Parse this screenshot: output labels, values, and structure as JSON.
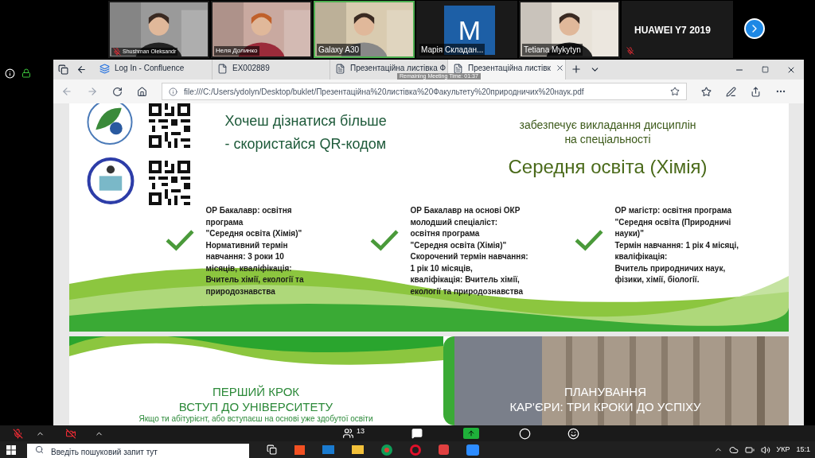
{
  "participants": [
    {
      "kind": "video",
      "name": "Shushman Oleksandr",
      "muted": true,
      "speaking": false
    },
    {
      "kind": "video",
      "name": "Неля Долинко",
      "muted": false,
      "speaking": false
    },
    {
      "kind": "video",
      "name": "Galaxy A30",
      "muted": false,
      "speaking": true
    },
    {
      "kind": "avatar",
      "initial": "M",
      "name": "Марія Складан...",
      "muted": false,
      "speaking": false
    },
    {
      "kind": "video",
      "name": "Tetiana Mykytyn",
      "muted": false,
      "speaking": false
    },
    {
      "kind": "name",
      "name": "HUAWEI Y7 2019",
      "muted": true,
      "speaking": false
    }
  ],
  "browser": {
    "tabs": [
      {
        "label": "Log In - Confluence",
        "selected": false
      },
      {
        "label": "EX002889",
        "selected": false
      },
      {
        "label": "Презентаційна листівка Ф",
        "selected": false
      },
      {
        "label": "Презентаційна листівк",
        "selected": true
      }
    ],
    "meeting_timer": "Remaining Meeting Time: 01:37",
    "url": "file:///C:/Users/ydolyn/Desktop/buklet/Презентаційна%20листівка%20Факультету%20природничих%20наук.pdf"
  },
  "pdf": {
    "qr_text": "Хочеш дізнатися більше - скористайся QR-кодом",
    "provides": [
      "забезпечує викладання дисциплін",
      "на спеціальності"
    ],
    "specialty": "Середня освіта (Хімія)",
    "programs": [
      {
        "lines": [
          "ОР Бакалавр: освітня",
          "програма",
          "\"Середня освіта (Хімія)\"",
          "Нормативний термін",
          "навчання: 3 роки 10",
          "місяців, кваліфікація:",
          "Вчитель хімії, екології та",
          "природознавства"
        ]
      },
      {
        "lines": [
          "ОР Бакалавр на основі ОКР",
          "молодший спеціаліст:",
          "освітня програма",
          "\"Середня освіта (Хімія)\"",
          "Скорочений термін навчання:",
          "1 рік 10 місяців,",
          "кваліфікація: Вчитель хімії,",
          "екології та природознавства"
        ]
      },
      {
        "lines": [
          "ОР магістр: освітня програма",
          "\"Середня освіта (Природничі",
          "науки)\"",
          "Термін навчання: 1 рік 4 місяці,",
          "кваліфікація:",
          "Вчитель природничих наук,",
          "фізики, хімії, біології."
        ]
      }
    ],
    "first_step": [
      "ПЕРШИЙ КРОК",
      "ВСТУП ДО УНІВЕРСИТЕТУ"
    ],
    "first_step_note": "Якщо ти абітурієнт, або вступаєш на основі уже здобутої освіти",
    "career": [
      "ПЛАНУВАННЯ",
      "КАР'ЄРИ: ТРИ КРОКИ ДО УСПІХУ"
    ]
  },
  "meeting_controls": {
    "mic_muted": true,
    "video_off": true,
    "participant_count": "13"
  },
  "taskbar": {
    "search_placeholder": "Введіть пошуковий запит тут",
    "language": "УКР",
    "time": "15:1"
  }
}
